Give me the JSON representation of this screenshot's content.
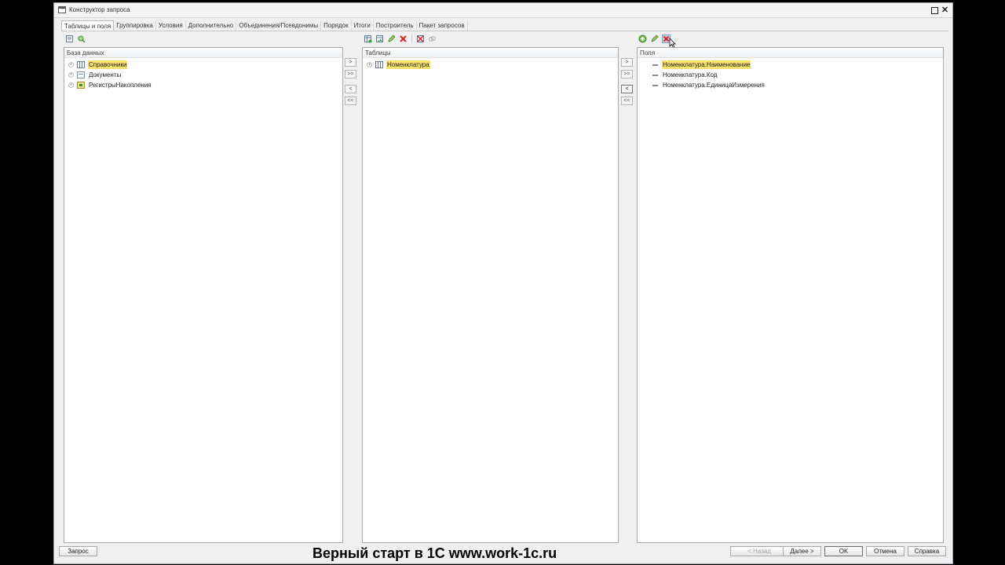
{
  "window": {
    "title": "Конструктор запроса",
    "maximize_glyph": "□",
    "close_glyph": "✕"
  },
  "tabs": [
    {
      "label": "Таблицы и поля",
      "active": true
    },
    {
      "label": "Группировка"
    },
    {
      "label": "Условия"
    },
    {
      "label": "Дополнительно"
    },
    {
      "label": "Объединения/Псевдонимы"
    },
    {
      "label": "Порядок"
    },
    {
      "label": "Итоги"
    },
    {
      "label": "Построитель"
    },
    {
      "label": "Пакет запросов"
    }
  ],
  "database_panel": {
    "header": "База данных",
    "toolbar_icons": [
      "list-icon",
      "find-icon"
    ],
    "items": [
      {
        "label": "Справочники",
        "icon": "table-icon",
        "selected": true
      },
      {
        "label": "Документы",
        "icon": "document-icon"
      },
      {
        "label": "РегистрыНакопления",
        "icon": "register-icon"
      }
    ]
  },
  "tables_panel": {
    "header": "Таблицы",
    "toolbar_icons": [
      "add-table-icon",
      "replace-table-icon",
      "edit-icon",
      "delete-icon",
      "delete-all-icon",
      "link-icon"
    ],
    "items": [
      {
        "label": "Номенклатура",
        "icon": "table-icon",
        "selected": true
      }
    ]
  },
  "fields_panel": {
    "header": "Поля",
    "toolbar_icons": [
      "add-icon",
      "edit-icon",
      "remove-icon"
    ],
    "items": [
      {
        "label": "Номенклатура.Наименование",
        "selected": true
      },
      {
        "label": "Номенклатура.Код"
      },
      {
        "label": "Номенклатура.ЕдиницаИзмерения"
      }
    ]
  },
  "move_buttons": {
    "move_one": ">",
    "move_all": ">>",
    "back_one": "<",
    "back_all": "<<"
  },
  "footer": {
    "query": "Запрос",
    "back": "< Назад",
    "next": "Далее >",
    "ok": "OK",
    "cancel": "Отмена",
    "help": "Справка"
  },
  "watermark": "Верный старт в 1С www.work-1c.ru"
}
